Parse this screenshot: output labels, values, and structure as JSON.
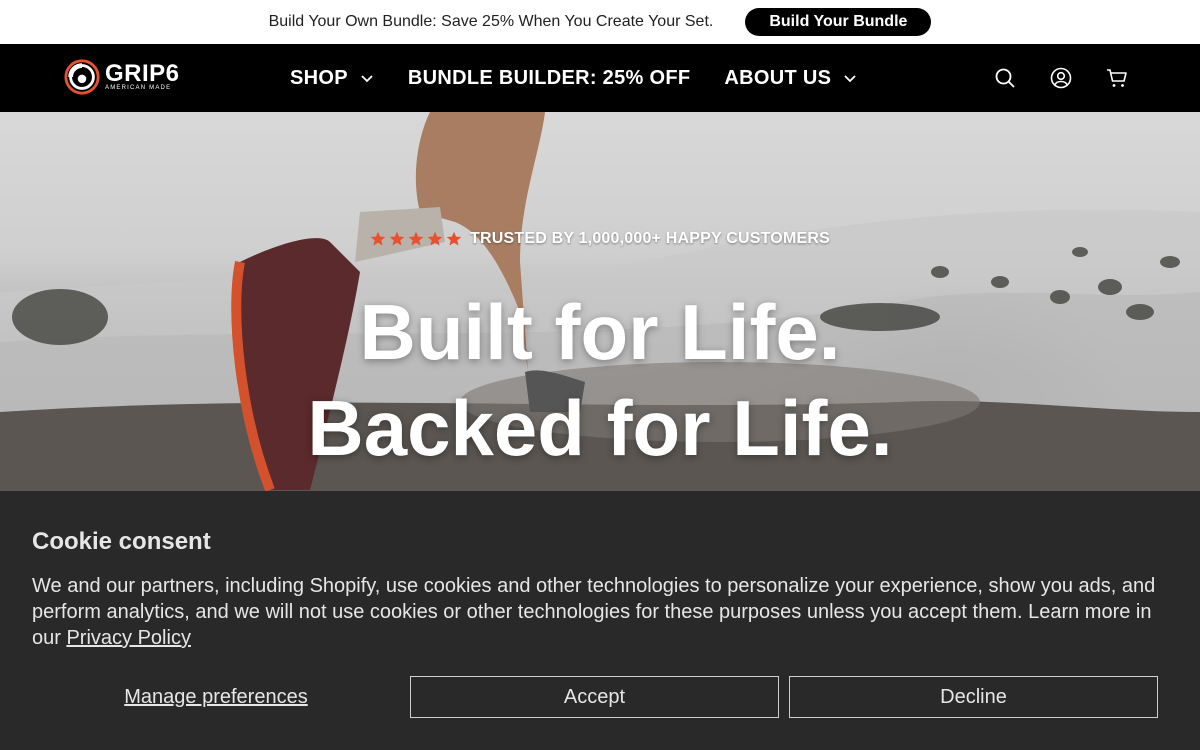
{
  "announcement": {
    "text": "Build Your Own Bundle: Save 25% When You Create Your Set.",
    "button_label": "Build Your Bundle"
  },
  "header": {
    "logo": {
      "name": "GRIP6",
      "tagline": "AMERICAN MADE"
    },
    "nav": [
      {
        "label": "SHOP",
        "has_dropdown": true
      },
      {
        "label": "BUNDLE BUILDER: 25% OFF",
        "has_dropdown": false
      },
      {
        "label": "ABOUT US",
        "has_dropdown": true
      }
    ],
    "icons": [
      "search-icon",
      "account-icon",
      "cart-icon"
    ]
  },
  "hero": {
    "rating_stars": 5,
    "trust_text": "TRUSTED BY 1,000,000+ HAPPY CUSTOMERS",
    "headline_line1": "Built for Life.",
    "headline_line2": "Backed for Life.",
    "star_color": "#e8512e"
  },
  "cookie": {
    "title": "Cookie consent",
    "body": "We and our partners, including Shopify, use cookies and other technologies to personalize your experience, show you ads, and perform analytics, and we will not use cookies or other technologies for these purposes unless you accept them. Learn more in our",
    "privacy_link": "Privacy Policy",
    "manage_label": "Manage preferences",
    "accept_label": "Accept",
    "decline_label": "Decline"
  },
  "colors": {
    "accent": "#e8512e",
    "header_bg": "#000000",
    "banner_bg": "#292929"
  }
}
